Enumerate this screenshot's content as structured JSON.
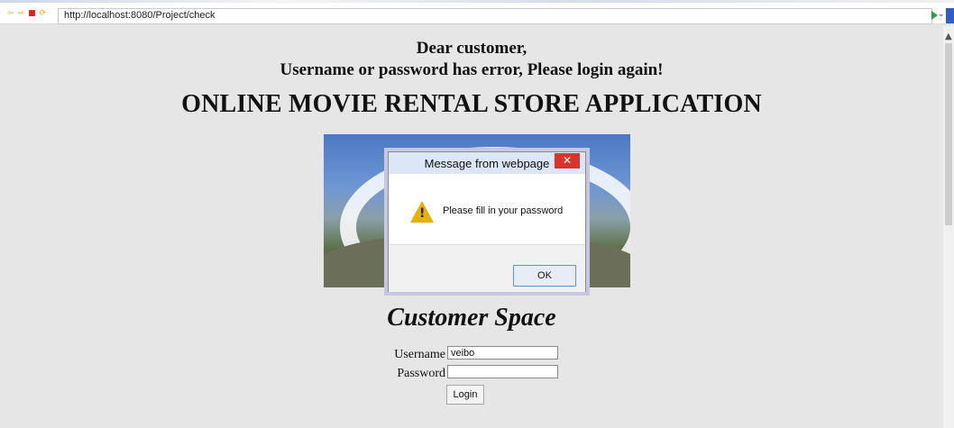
{
  "browser": {
    "url": "http://localhost:8080/Project/check"
  },
  "page": {
    "greeting": "Dear customer,",
    "error_message": "Username or password has error, Please login again!",
    "title": "ONLINE MOVIE RENTAL STORE APPLICATION",
    "subtitle": "Customer Space",
    "form": {
      "username_label": "Username",
      "username_value": "veibo",
      "password_label": "Password",
      "password_value": "",
      "login_label": "Login"
    }
  },
  "dialog": {
    "title": "Message from webpage",
    "message": "Please fill in your password",
    "ok_label": "OK",
    "close_symbol": "✕"
  },
  "icons": {
    "back": "back-icon",
    "forward": "forward-icon",
    "stop": "stop-icon",
    "refresh": "refresh-icon",
    "warning": "warning-icon",
    "dropdown": "chevron-down-icon",
    "go": "go-icon"
  },
  "colors": {
    "page_bg": "#e6e6e6",
    "close_red": "#d9342b",
    "warning_yellow": "#e6b000",
    "accent_blue": "#2f5ec4"
  }
}
